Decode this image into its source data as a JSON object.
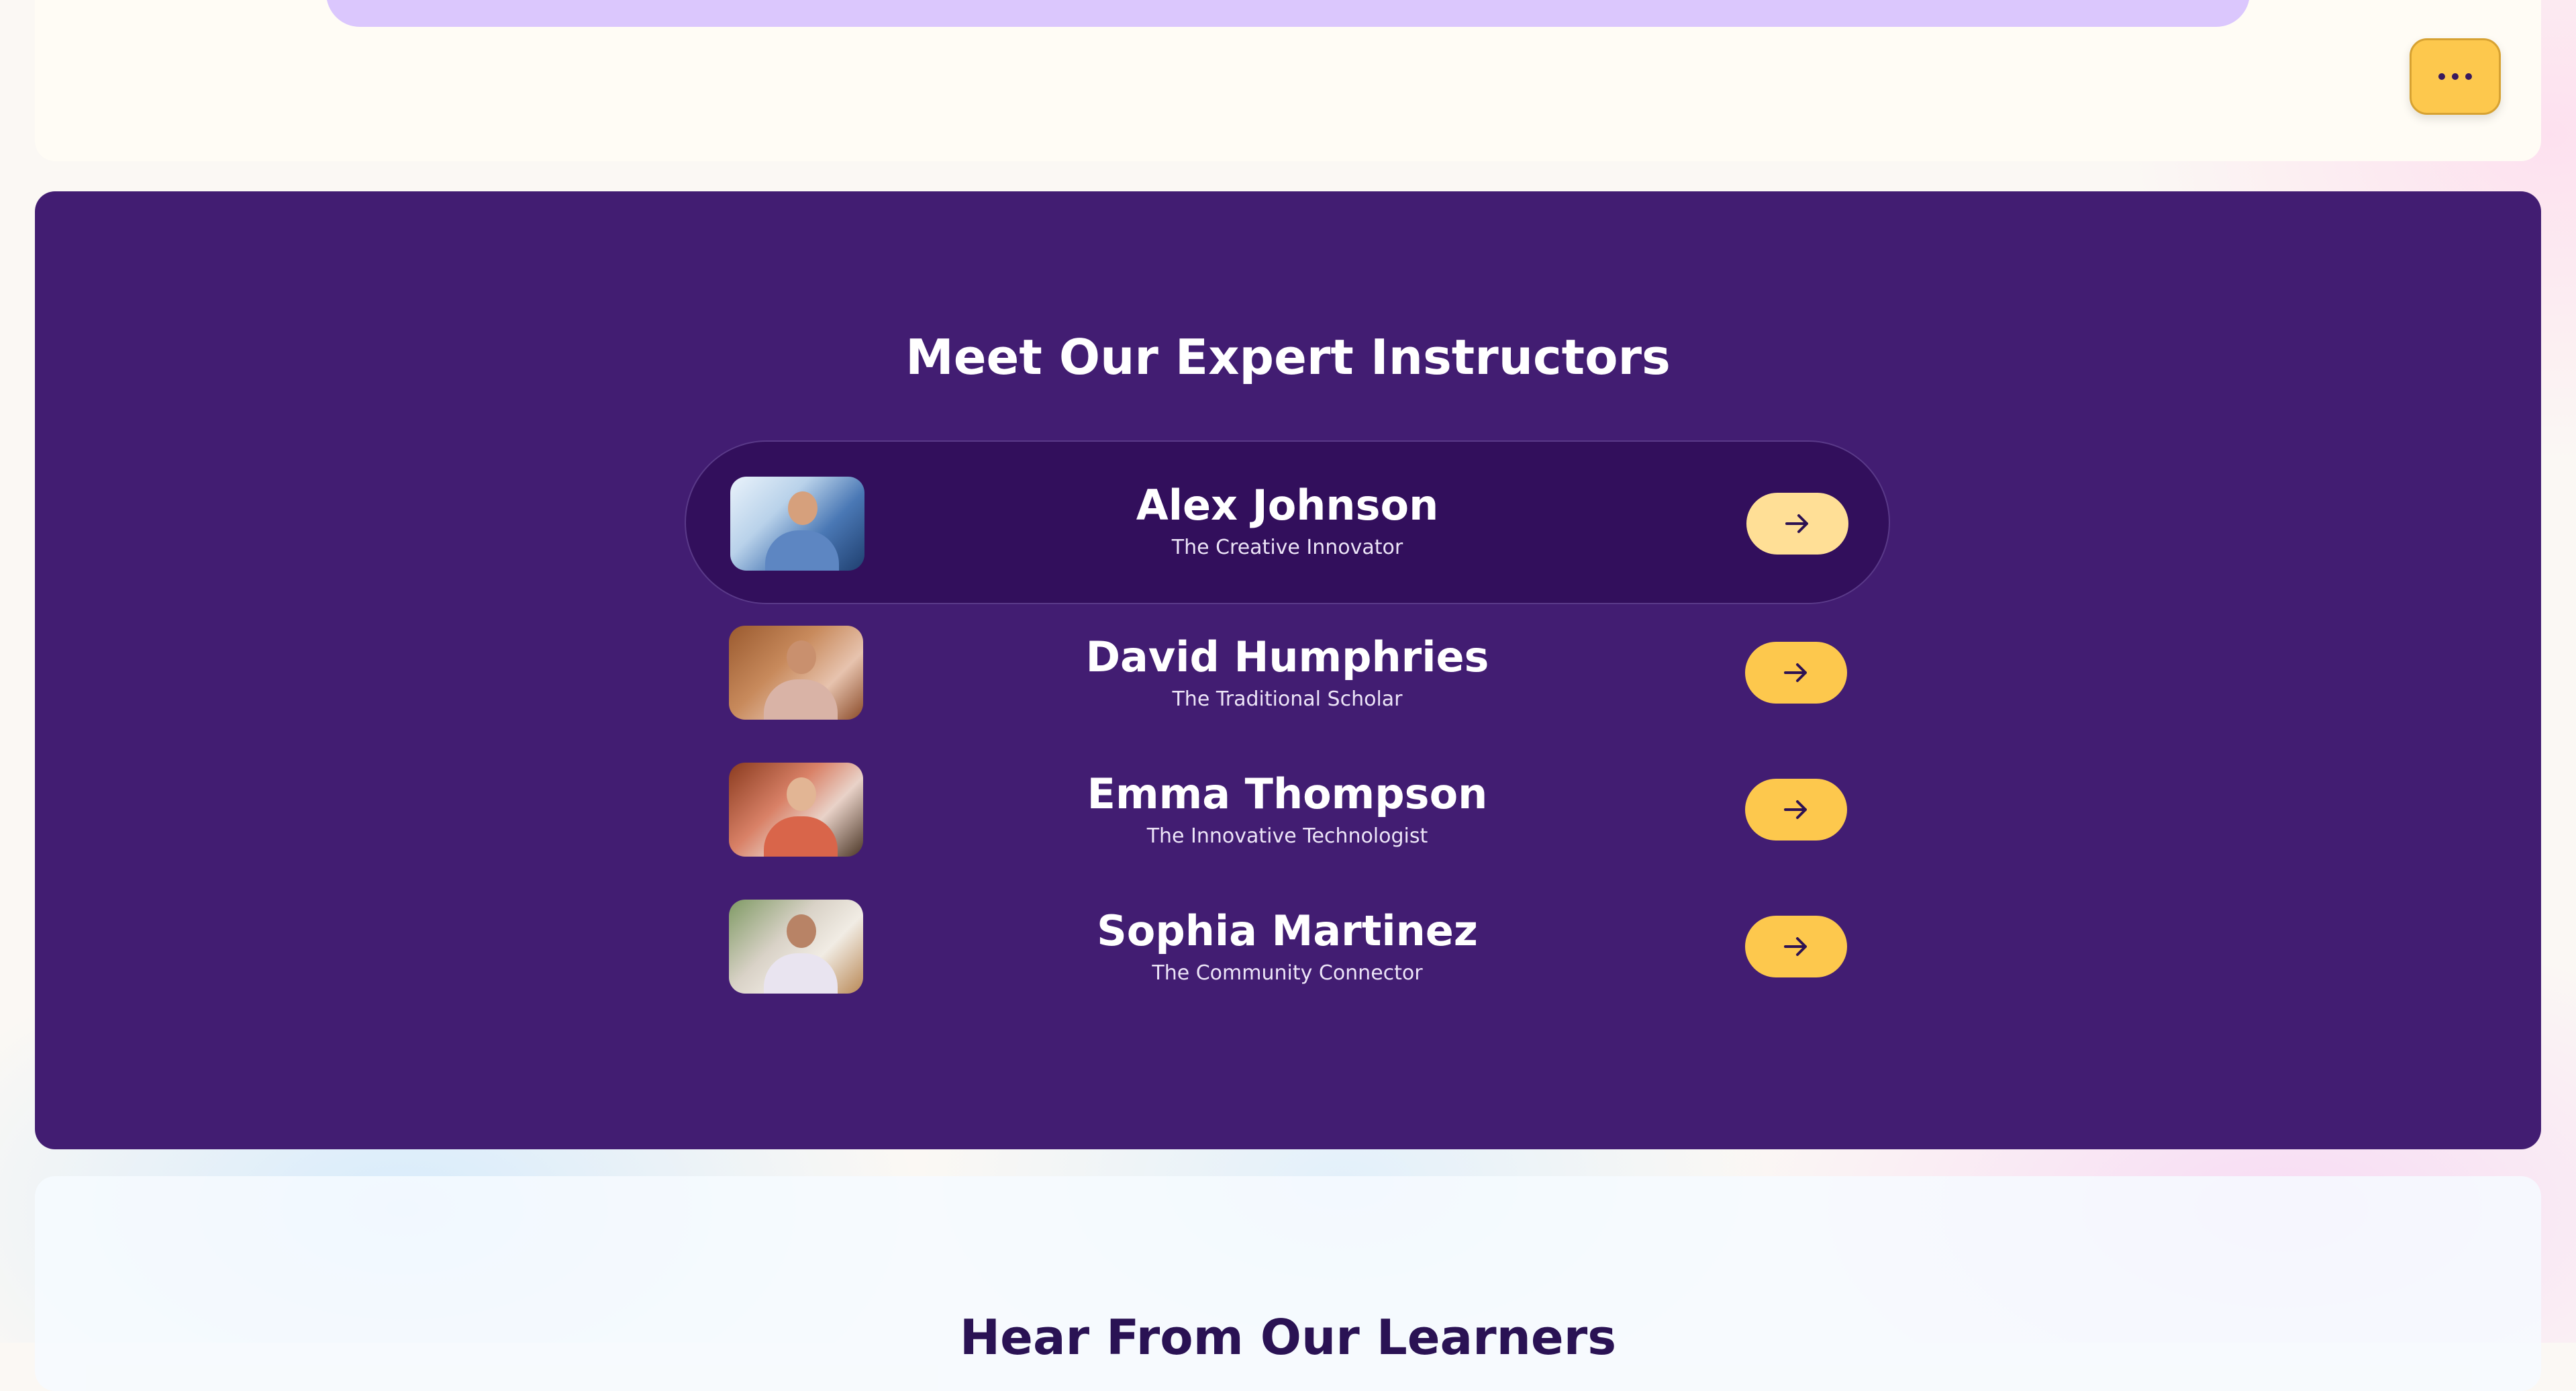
{
  "header": {
    "more_button_icon": "more-horizontal-icon"
  },
  "instructors_section": {
    "title": "Meet Our Expert Instructors",
    "items": [
      {
        "name": "Alex Johnson",
        "role": "The Creative Innovator",
        "active": true,
        "arrow_icon": "arrow-right-icon"
      },
      {
        "name": "David Humphries",
        "role": "The Traditional Scholar",
        "active": false,
        "arrow_icon": "arrow-right-icon"
      },
      {
        "name": "Emma Thompson",
        "role": "The Innovative Technologist",
        "active": false,
        "arrow_icon": "arrow-right-icon"
      },
      {
        "name": "Sophia Martinez",
        "role": "The Community Connector",
        "active": false,
        "arrow_icon": "arrow-right-icon"
      }
    ]
  },
  "testimonials_section": {
    "title": "Hear From Our Learners"
  },
  "colors": {
    "panel": "#421d72",
    "active_row": "#320f5c",
    "accent": "#fdc84d",
    "accent_light": "#ffdf96",
    "top_pill": "#dbc7fd"
  }
}
